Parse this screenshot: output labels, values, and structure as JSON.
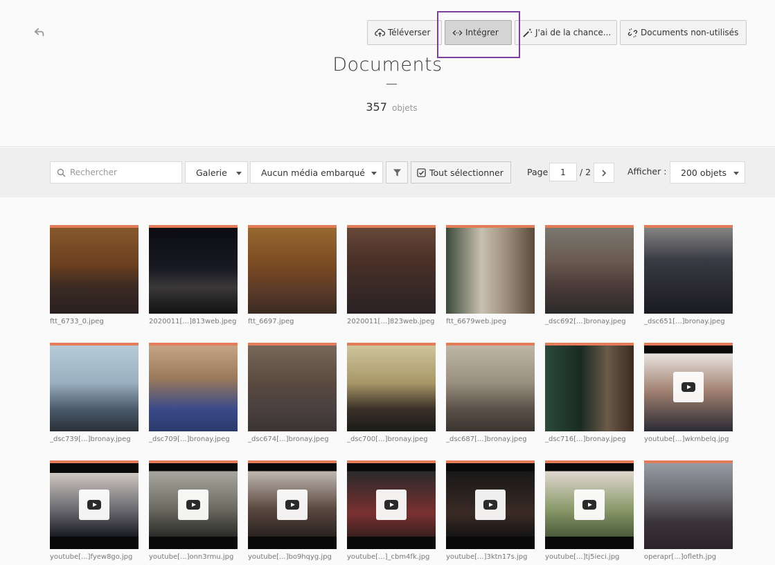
{
  "header": {
    "title": "Documents",
    "count_number": "357",
    "count_label": "objets"
  },
  "toolbar": {
    "upload": "Téléverser",
    "embed": "Intégrer",
    "lucky": "J'ai de la chance...",
    "unused": "Documents non-utilisés"
  },
  "filters": {
    "search_placeholder": "Rechercher",
    "view_mode": "Galerie",
    "media_filter": "Aucun média embarqué",
    "select_all": "Tout sélectionner",
    "page_label": "Page",
    "page_current": "1",
    "page_total": "/ 2",
    "show_label": "Afficher :",
    "per_page": "200 objets"
  },
  "colors": {
    "accent_bar": "#e47d57",
    "highlight": "#7b3fa0"
  },
  "documents": [
    {
      "filename": "ftt_6733_0.jpeg",
      "video": false
    },
    {
      "filename": "2020011[...]813web.jpeg",
      "video": false
    },
    {
      "filename": "ftt_6697.jpeg",
      "video": false
    },
    {
      "filename": "2020011[...]823web.jpeg",
      "video": false
    },
    {
      "filename": "ftt_6679web.jpeg",
      "video": false
    },
    {
      "filename": "_dsc692[...]bronay.jpeg",
      "video": false
    },
    {
      "filename": "_dsc651[...]bronay.jpeg",
      "video": false
    },
    {
      "filename": "_dsc739[...]bronay.jpeg",
      "video": false
    },
    {
      "filename": "_dsc709[...]bronay.jpeg",
      "video": false
    },
    {
      "filename": "_dsc674[...]bronay.jpeg",
      "video": false
    },
    {
      "filename": "_dsc700[...]bronay.jpeg",
      "video": false
    },
    {
      "filename": "_dsc687[...]bronay.jpeg",
      "video": false
    },
    {
      "filename": "_dsc716[...]bronay.jpeg",
      "video": false
    },
    {
      "filename": "youtube[...]wkmbelq.jpg",
      "video": true
    },
    {
      "filename": "youtube[...]fyew8go.jpg",
      "video": true
    },
    {
      "filename": "youtube[...]onn3rmu.jpg",
      "video": true
    },
    {
      "filename": "youtube[...]bo9hqyg.jpg",
      "video": true
    },
    {
      "filename": "youtube[...]_cbm4fk.jpg",
      "video": true
    },
    {
      "filename": "youtube[...]3ktn17s.jpg",
      "video": true
    },
    {
      "filename": "youtube[...]tj5ieci.jpg",
      "video": true
    },
    {
      "filename": "operapr[...]ofleth.jpg",
      "video": false
    }
  ]
}
